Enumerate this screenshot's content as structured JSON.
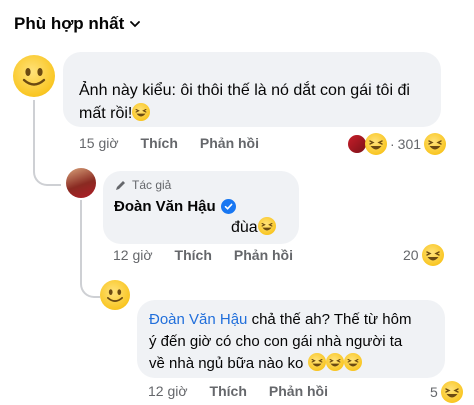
{
  "header": {
    "sort_label": "Phù hợp nhất"
  },
  "comment1": {
    "text_line1": "Ảnh này kiểu: ôi thôi thế là nó dắt con gái tôi đi",
    "text_line2": "mất rồi!",
    "time": "15 giờ",
    "like": "Thích",
    "reply": "Phản hồi",
    "reaction_count": "301"
  },
  "comment2": {
    "badge": "Tác giả",
    "author": "Đoàn Văn Hậu",
    "text": "đùa",
    "time": "12 giờ",
    "like": "Thích",
    "reply": "Phản hồi",
    "reaction_count": "20"
  },
  "comment3": {
    "mention": "Đoàn Văn Hậu",
    "text_after_mention": " chả thế ah? Thế từ hôm",
    "text_line2": "ý đến giờ có cho con gái nhà người ta",
    "text_line3": "về nhà ngủ bữa nào ko",
    "time": "12 giờ",
    "like": "Thích",
    "reply": "Phản hồi",
    "reaction_count": "5"
  },
  "icons": {
    "sort": "chevron-down-icon",
    "avatar_default": "smiley-face-icon",
    "reaction": "laughing-emoji-icon",
    "author_badge": "pen-icon",
    "verified": "verified-check-icon"
  },
  "colors": {
    "mention": "#216fdb",
    "verified": "#1877f2",
    "bubble": "#f0f2f5"
  }
}
